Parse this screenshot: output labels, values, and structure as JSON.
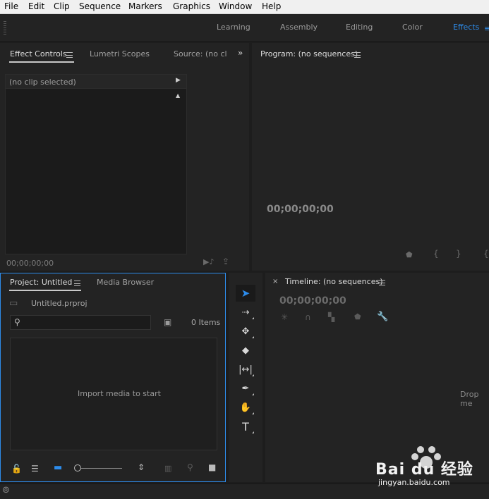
{
  "menubar": {
    "items": [
      "File",
      "Edit",
      "Clip",
      "Sequence",
      "Markers",
      "Graphics",
      "Window",
      "Help"
    ]
  },
  "workspaces": {
    "tabs": [
      "Learning",
      "Assembly",
      "Editing",
      "Color",
      "Effects"
    ],
    "active": "Effects"
  },
  "effect_controls": {
    "tabs": [
      "Effect Controls",
      "Lumetri Scopes",
      "Source: (no cl"
    ],
    "clip_header": "(no clip selected)",
    "timecode": "00;00;00;00"
  },
  "program": {
    "title": "Program: (no sequences)",
    "timecode": "00;00;00;00"
  },
  "project": {
    "tabs": [
      "Project: Untitled",
      "Media Browser"
    ],
    "file_name": "Untitled.prproj",
    "search_value": "",
    "item_count": "0 Items",
    "empty_message": "Import media to start"
  },
  "timeline": {
    "close_glyph": "×",
    "title": "Timeline: (no sequences)",
    "timecode": "00;00;00;00",
    "drop_message": "Drop me"
  },
  "tools": [
    "selection-tool",
    "track-select-tool",
    "ripple-edit-tool",
    "razor-tool",
    "slip-tool",
    "pen-tool",
    "hand-tool",
    "type-tool"
  ],
  "watermark": {
    "brand": "Bai du 经验",
    "url": "jingyan.baidu.com"
  },
  "colors": {
    "accent": "#2d8ceb",
    "panel_bg": "#232323",
    "app_bg": "#1d1d1d",
    "menubar_bg": "#f0f0f0"
  }
}
